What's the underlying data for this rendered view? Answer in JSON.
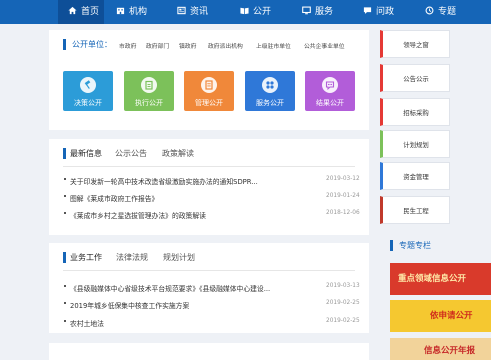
{
  "nav": {
    "items": [
      {
        "label": "首页",
        "icon": "home-icon"
      },
      {
        "label": "机构",
        "icon": "building-icon"
      },
      {
        "label": "资讯",
        "icon": "newspaper-icon"
      },
      {
        "label": "公开",
        "icon": "book-icon"
      },
      {
        "label": "服务",
        "icon": "monitor-icon"
      },
      {
        "label": "问政",
        "icon": "chat-icon"
      },
      {
        "label": "专题",
        "icon": "topic-icon"
      }
    ]
  },
  "units": {
    "title": "公开单位：",
    "links": [
      "市政府",
      "政府部门",
      "镇政府",
      "政府派出机构",
      "上级驻市单位",
      "公共企事业单位"
    ]
  },
  "tiles": [
    {
      "label": "决策公开",
      "color": "#2c9cd8",
      "icon": "gavel-icon"
    },
    {
      "label": "执行公开",
      "color": "#7cc15a",
      "icon": "clipboard-icon"
    },
    {
      "label": "管理公开",
      "color": "#f0883a",
      "icon": "document-icon"
    },
    {
      "label": "服务公开",
      "color": "#2f78d8",
      "icon": "grid-icon"
    },
    {
      "label": "结果公开",
      "color": "#b25dd9",
      "icon": "result-icon"
    }
  ],
  "news_panel": {
    "tabs": [
      "最新信息",
      "公示公告",
      "政策解读"
    ],
    "items": [
      {
        "text": "关于印发新一轮高中技术改造省级激励实施办法的通知SDPR...",
        "date": "2019-03-12"
      },
      {
        "text": "图解《莱成市政府工作报告》",
        "date": "2019-01-24"
      },
      {
        "text": "《莱成市乡村之星选拔管理办法》的政策解读",
        "date": "2018-12-06"
      }
    ]
  },
  "biz_panel": {
    "tabs": [
      "业务工作",
      "法律法规",
      "规划计划"
    ],
    "items": [
      {
        "text": "《县级融媒体中心省级技术平台规范要求》《县级融媒体中心建设...",
        "date": "2019-03-13"
      },
      {
        "text": "2019年城乡低保集中核查工作实施方案",
        "date": "2019-02-25"
      },
      {
        "text": "农村土地法",
        "date": "2019-02-25"
      }
    ]
  },
  "sidebar": {
    "items": [
      "领导之窗",
      "公告公示",
      "招标采购",
      "计划规划",
      "资金管理",
      "民生工程"
    ],
    "special_title": "专题专栏",
    "banners": [
      {
        "text": "重点领域信息公开",
        "bg": "#d93a2b",
        "color": "#ffe9a8"
      },
      {
        "text": "依申请公开",
        "bg": "#f5c830",
        "color": "#d02a1c"
      },
      {
        "text": "信息公开年报",
        "bg": "#f2d39a",
        "color": "#c62828"
      }
    ]
  },
  "colors": {
    "primary": "#1565b7",
    "sidebar_accent": "#e53935"
  }
}
